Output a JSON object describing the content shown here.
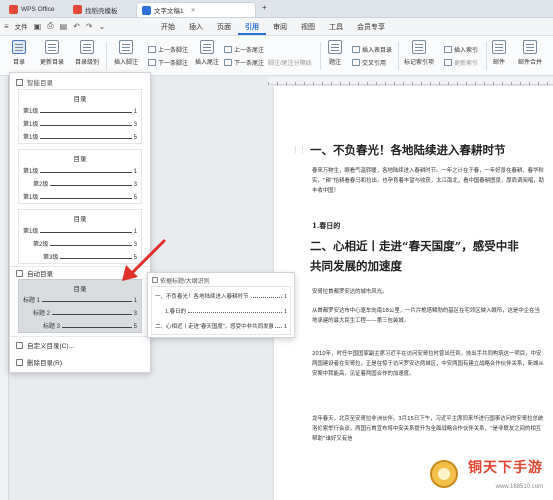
{
  "titlebar": {
    "tabs": [
      {
        "label": "WPS Office",
        "logo_color": "#e04a3a"
      },
      {
        "label": "找稻壳模板",
        "logo_color": "#e04a3a"
      },
      {
        "label": "文字文稿1",
        "logo_color": "#2b6fd8"
      }
    ],
    "new_tab": "+"
  },
  "menubar": {
    "file": "文件",
    "tabs": [
      "开始",
      "插入",
      "页面",
      "引用",
      "审阅",
      "视图",
      "工具",
      "会员专享"
    ],
    "active_tab": "引用"
  },
  "ribbon": {
    "toc": "目录",
    "update_toc": "更新目录",
    "toc_level": "目录级别",
    "insert_footnote": "插入脚注",
    "prev_footnote": "上一条脚注",
    "next_footnote": "下一条脚注",
    "insert_endnote": "插入尾注",
    "prev_endnote": "上一条尾注",
    "next_endnote": "下一条尾注",
    "footnote_sep": "脚注/尾注分隔线",
    "caption": "题注",
    "insert_table_of_figures": "插入表目录",
    "cross_reference": "交叉引用",
    "mark_index": "标记索引项",
    "insert_index": "插入索引",
    "update_index": "更新索引",
    "mail": "邮件",
    "mail_merge": "邮件合并"
  },
  "dropdown": {
    "header": "智能目录",
    "templates": [
      {
        "title": "目录",
        "rows": [
          {
            "label": "第1级",
            "page": "1"
          },
          {
            "label": "第1级",
            "page": "3"
          },
          {
            "label": "第1级",
            "page": "5"
          }
        ]
      },
      {
        "title": "目录",
        "rows": [
          {
            "label": "第1级",
            "page": "1"
          },
          {
            "label": "第2级",
            "page": "3"
          },
          {
            "label": "第1级",
            "page": "5"
          }
        ]
      },
      {
        "title": "目录",
        "rows": [
          {
            "label": "第1级",
            "page": "1"
          },
          {
            "label": "第2级",
            "page": "3"
          },
          {
            "label": "第3级",
            "page": "5"
          }
        ]
      }
    ],
    "auto_toc": "自动目录",
    "auto_template": {
      "title": "目录",
      "rows": [
        {
          "label": "标题 1",
          "page": "1"
        },
        {
          "label": "标题 2",
          "page": "3"
        },
        {
          "label": "标题 3",
          "page": "5"
        }
      ]
    },
    "custom_toc": "自定义目录(C)...",
    "delete_toc": "删除目录(R)"
  },
  "flyout": {
    "title": "依据标题/大纲识别",
    "rows": [
      {
        "label": "一、不负春光！各地陆续进入春耕时节",
        "page": "1"
      },
      {
        "label": "1.春日的",
        "page": "1"
      },
      {
        "label": "二、心相近丨走进“春天国度”，感受中非共同发展的加速度",
        "page": "1"
      }
    ]
  },
  "document": {
    "h1_a": "一、不负春光！各地陆续进入春耕时节",
    "p1": "春来万物生，眼看气温转暖，各地陆续进入春耕时节。一年之计在于春，一年好景在春耕，春华秋实，“耕”恰耕看春马和拉出，也孕育着丰望与收获，太江南北，看中国春耕图景，厚肩调阅唱，助丰收中国！",
    "h2": "1.春日的",
    "h1_b_line1": "二、心相近丨走进“春天国度”，感受中非",
    "h1_b_line2": "共同发展的加速度",
    "p2": "安哥拉首都罗安达的城市风光。",
    "p3": "从首都罗安达市中心驱车向南18公里，一片片桅塔鳞勃的基区在宅郊区映入眼帘，这是中企在当地承建的最大民生工程——第三包装城。",
    "p4": "2010年，时任中国国家副主席习近平在访问安哥拉时曾出任到。技出手共同构筑这一项目，中安两国建设者在安哥拉，正是在惊于访问罗安达两城区，中安两国有建立战略合作伙伴关系，新城从安案中我能高，见证着两国合作的加速度。",
    "p5": "龙年春天，北京至安哥拉非洲伙伴。3月15日下午，习近平主席同来华进行国事访问的安哥拉总统洛伦索举行会谈，两国元首宣布将中安关系提升为全面战略合作伙伴关系，“是非联友之间的相互帮助”谁好又有信"
  },
  "watermark": {
    "brand": "铜天下手游",
    "url": "www.168510.com"
  }
}
